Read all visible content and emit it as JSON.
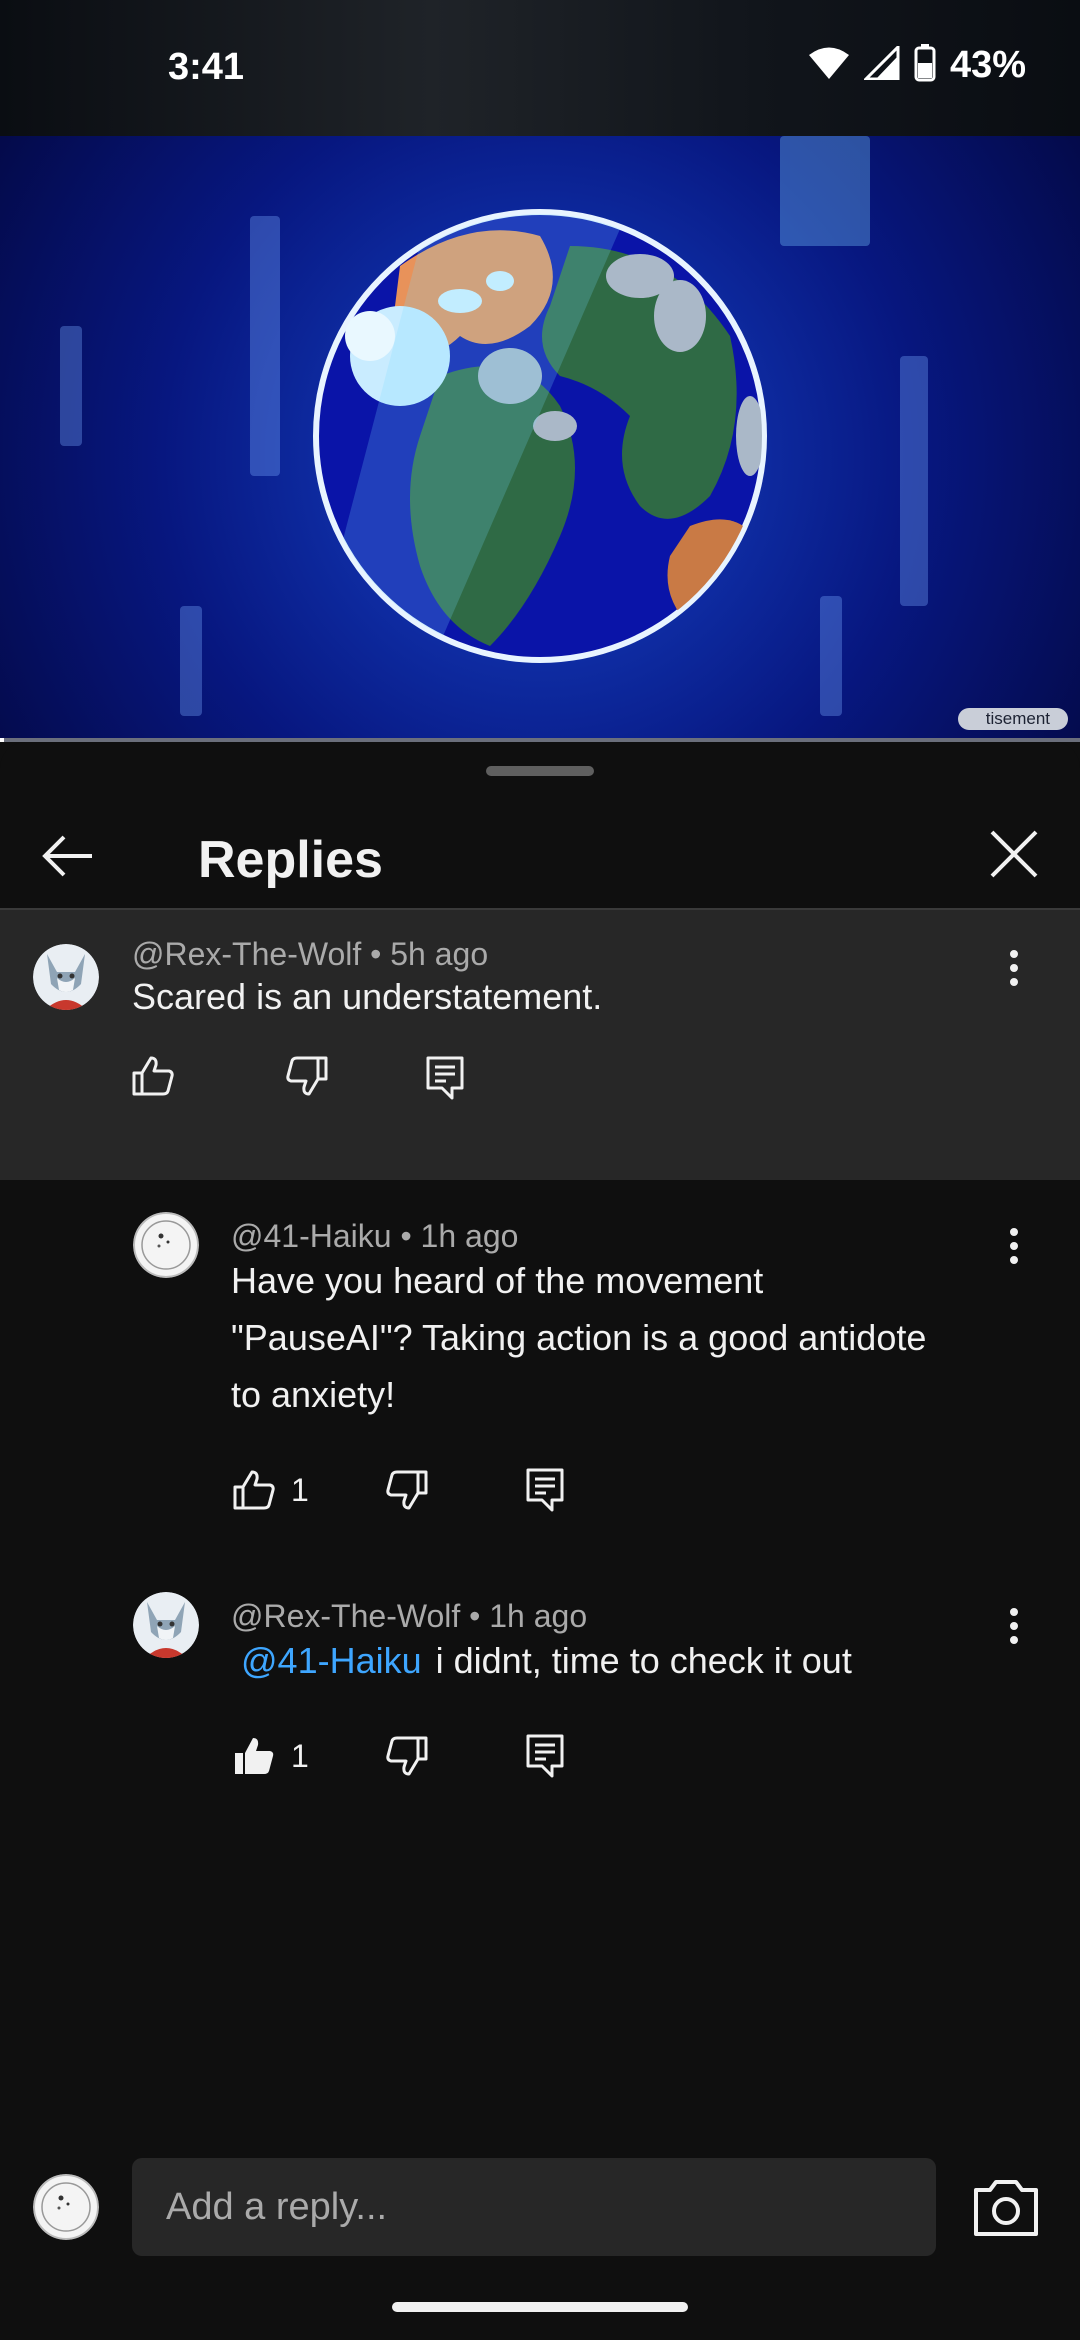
{
  "status_bar": {
    "time": "3:41",
    "battery_pct": "43%"
  },
  "video": {
    "ad_label": "tisement",
    "progress": 0.004
  },
  "sheet": {
    "title": "Replies"
  },
  "comments": [
    {
      "author": "@Rex-The-Wolf",
      "age": "5h ago",
      "text": "Scared is an understatement.",
      "likes": ""
    },
    {
      "author": "@41-Haiku",
      "age": "1h ago",
      "text_lines": [
        "Have you heard of the movement",
        "\"PauseAI\"? Taking action is a good antidote",
        "to anxiety!"
      ],
      "likes": "1"
    },
    {
      "author": "@Rex-The-Wolf",
      "age": "1h ago",
      "mention": "@41-Haiku",
      "text": "i didnt, time to check it out",
      "likes": "1",
      "liked": true
    }
  ],
  "separator": "•",
  "composer": {
    "placeholder": "Add a reply..."
  },
  "icons": {
    "wifi": "wifi-icon",
    "signal": "signal-icon",
    "battery": "battery-icon",
    "back": "arrow-left-icon",
    "close": "close-icon",
    "more": "more-vert-icon",
    "like": "thumb-up-icon",
    "dislike": "thumb-down-icon",
    "reply": "comment-icon",
    "camera": "camera-icon"
  },
  "colors": {
    "background": "#0f0f0f",
    "surface": "#272727",
    "mention": "#3ea6ff",
    "meta_text": "#aaaaaa"
  }
}
